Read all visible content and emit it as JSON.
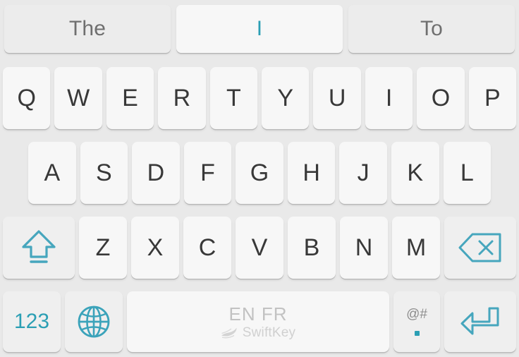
{
  "keyboard": {
    "name": "SwiftKey Keyboard",
    "accent_color": "#2b9fb4",
    "key_color": "#f7f7f7",
    "background_color": "#e9e9e9",
    "letter_color": "#383838"
  },
  "prediction_bar": {
    "candidates": [
      {
        "label": "The",
        "selected": false
      },
      {
        "label": "I",
        "selected": true
      },
      {
        "label": "To",
        "selected": false
      }
    ]
  },
  "rows": {
    "row1": [
      "Q",
      "W",
      "E",
      "R",
      "T",
      "Y",
      "U",
      "I",
      "O",
      "P"
    ],
    "row2": [
      "A",
      "S",
      "D",
      "F",
      "G",
      "H",
      "J",
      "K",
      "L"
    ],
    "row3_letters": [
      "Z",
      "X",
      "C",
      "V",
      "B",
      "N",
      "M"
    ]
  },
  "function_keys": {
    "shift": {
      "icon": "shift-arrow-icon",
      "label": ""
    },
    "backspace": {
      "icon": "backspace-icon",
      "label": ""
    },
    "numeric": {
      "label": "123",
      "icon": "numeric-mode-icon"
    },
    "globe": {
      "icon": "globe-icon",
      "label": ""
    },
    "enter": {
      "icon": "enter-return-icon",
      "label": ""
    }
  },
  "spacebar": {
    "languages": "EN FR",
    "brand": "SwiftKey",
    "brand_icon": "swiftkey-logo-icon"
  },
  "period_key": {
    "secondary_label": "@#",
    "primary_label": "."
  }
}
